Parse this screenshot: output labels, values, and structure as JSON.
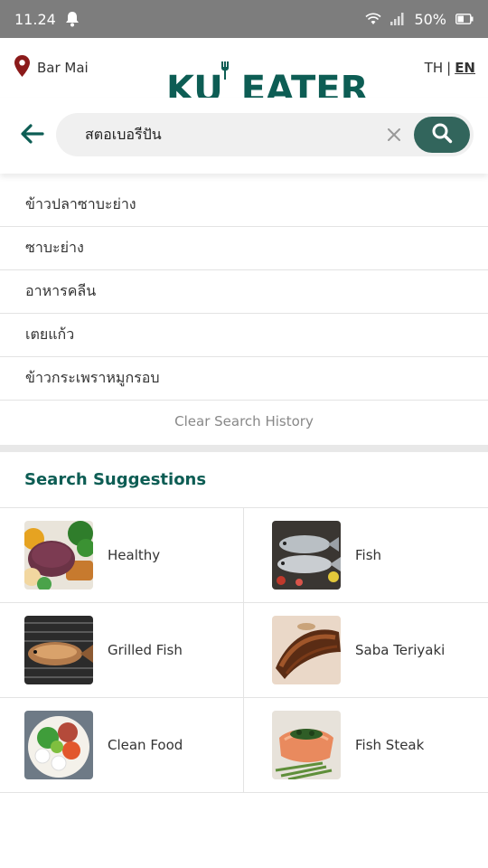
{
  "status_bar": {
    "time": "11.24",
    "battery": "50%"
  },
  "header": {
    "location": "Bar Mai",
    "logo_ku": "KU",
    "logo_eater": "EATER",
    "lang_th": "TH",
    "lang_sep": "|",
    "lang_en": "EN"
  },
  "search": {
    "value": "สตอเบอรี่ปั่น"
  },
  "history": {
    "items": [
      "ข้าวปลาซาบะย่าง",
      "ซาบะย่าง",
      "อาหารคลีน",
      "เตยแก้ว",
      "ข้าวกระเพราหมูกรอบ"
    ],
    "clear_label": "Clear Search History"
  },
  "suggestions": {
    "title": "Search Suggestions",
    "items": [
      {
        "label": "Healthy"
      },
      {
        "label": "Fish"
      },
      {
        "label": "Grilled Fish"
      },
      {
        "label": "Saba Teriyaki"
      },
      {
        "label": "Clean Food"
      },
      {
        "label": "Fish Steak"
      }
    ]
  },
  "colors": {
    "brand": "#0d5d54",
    "search_button": "#32655c",
    "status_bar": "#7d7d7d"
  },
  "icons": [
    "bell-icon",
    "wifi-icon",
    "signal-icon",
    "battery-icon",
    "location-pin-icon",
    "back-arrow-icon",
    "clear-icon",
    "search-icon"
  ]
}
